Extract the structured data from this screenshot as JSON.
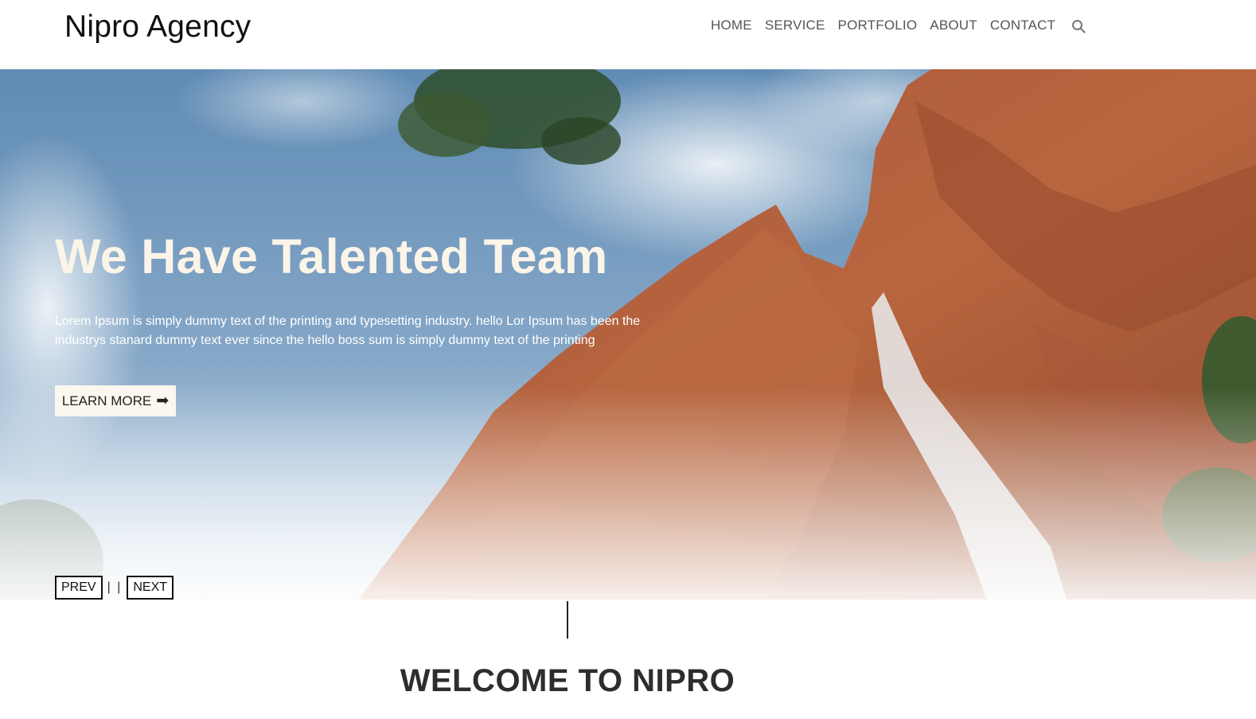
{
  "header": {
    "logo": "Nipro Agency",
    "nav": [
      "HOME",
      "SERVICE",
      "PORTFOLIO",
      "ABOUT",
      "CONTACT"
    ],
    "search_icon": "search-icon"
  },
  "hero": {
    "title": "We Have Talented Team",
    "text": "Lorem Ipsum is simply dummy text of the printing and typesetting industry. hello Lor Ipsum has been the industrys stanard dummy text ever since the hello boss sum is simply dummy text of the printing",
    "button_label": "LEARN MORE",
    "button_icon": "arrow-right-icon",
    "prev_label": "PREV",
    "separator": "| |",
    "next_label": "NEXT"
  },
  "welcome": {
    "title": "WELCOME TO NIPRO"
  },
  "colors": {
    "sky": "#6f95b9",
    "rock": "#b5603a",
    "title_cream": "#fbf4e8"
  }
}
